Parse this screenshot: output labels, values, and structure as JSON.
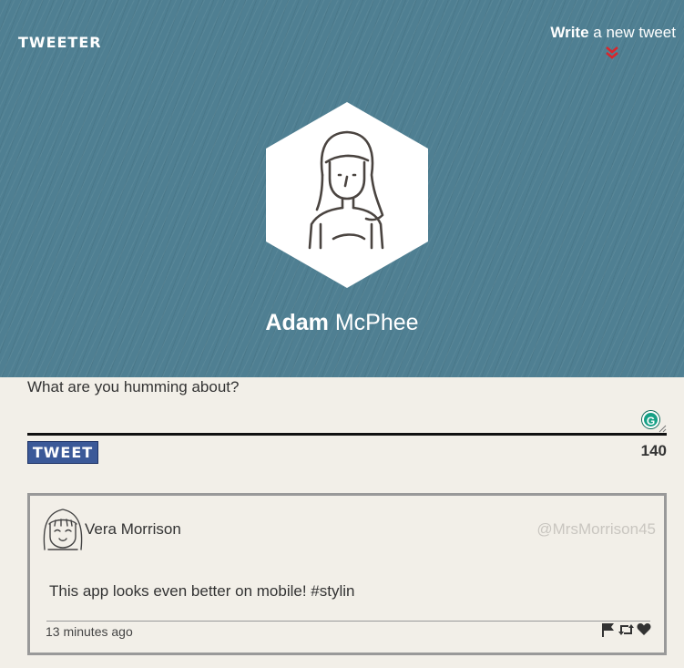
{
  "header": {
    "logo": "TWEETER",
    "compose_link": {
      "strong": "Write",
      "rest": " a new tweet"
    },
    "compose_icon": "double-chevron-down-icon"
  },
  "profile": {
    "first_name": "Adam",
    "last_name": "McPhee",
    "avatar_icon": "woman-avatar-icon"
  },
  "composer": {
    "prompt": "What are you humming about?",
    "value": "",
    "tweet_button": "TWEET",
    "char_count": "140",
    "grammarly_badge": "G"
  },
  "tweets": [
    {
      "author": "Vera Morrison",
      "handle": "@MrsMorrison45",
      "text": "This app looks even better on mobile! #stylin",
      "time": "13 minutes ago",
      "actions": [
        "flag-icon",
        "retweet-icon",
        "heart-icon"
      ]
    }
  ],
  "colors": {
    "hero": "#4f7f92",
    "background": "#f2efe8",
    "tweet_button": "#3b5998",
    "chevron": "#d9262c",
    "grammarly": "#15a085"
  }
}
